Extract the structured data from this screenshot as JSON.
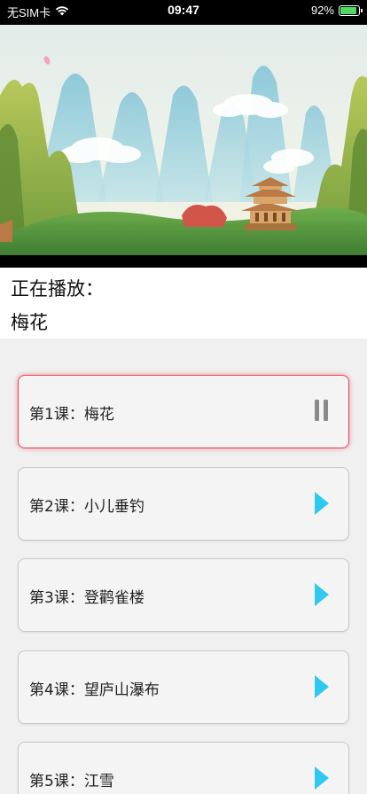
{
  "status_bar": {
    "carrier": "无SIM卡",
    "time": "09:47",
    "battery_percent": "92%",
    "battery_level": 0.92,
    "battery_color": "#4cd964"
  },
  "video": {
    "scene_icon": "landscape-illustration"
  },
  "now_playing": {
    "label": "正在播放：",
    "title": "梅花"
  },
  "lessons": [
    {
      "text": "第1课：梅花",
      "state": "playing",
      "icon": "pause-icon"
    },
    {
      "text": "第2课：小儿垂钓",
      "state": "idle",
      "icon": "play-icon"
    },
    {
      "text": "第3课：登鹳雀楼",
      "state": "idle",
      "icon": "play-icon"
    },
    {
      "text": "第4课：望庐山瀑布",
      "state": "idle",
      "icon": "play-icon"
    },
    {
      "text": "第5课：江雪",
      "state": "idle",
      "icon": "play-icon"
    }
  ],
  "colors": {
    "active_border": "#e8455b",
    "play_icon": "#2fc9f0",
    "pause_icon": "#8a8a8a"
  }
}
